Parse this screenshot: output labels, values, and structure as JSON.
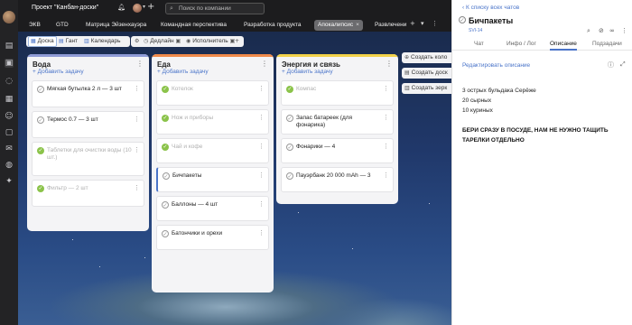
{
  "header": {
    "project_title": "Проект \"Канбан-доски\"",
    "search_placeholder": "Поиск по компании"
  },
  "tabs": [
    {
      "label": "ЭКВ"
    },
    {
      "label": "GTD"
    },
    {
      "label": "Матрица Эйзенхауэра"
    },
    {
      "label": "Командная перспектива"
    },
    {
      "label": "Разработка продукта"
    },
    {
      "label": "Апокалипсис",
      "active": true
    },
    {
      "label": "Развлечени"
    }
  ],
  "toolbar": {
    "board": "Доска",
    "gantt": "Гант",
    "calendar": "Календарь",
    "deadline": "Дедлайн",
    "assignee": "Исполнитель"
  },
  "add_task_label": "+ Добавить задачу",
  "columns": [
    {
      "title": "Вода",
      "color": "#8f9bd6",
      "cards": [
        {
          "text": "Мягкая бутылка 2 л — 3 шт",
          "done": false
        },
        {
          "text": "Термос 0.7 — 3 шт",
          "done": false
        },
        {
          "text": "Таблетки для очистки воды (10 шт.)",
          "done": true
        },
        {
          "text": "Фильтр — 2 шт",
          "done": true
        }
      ]
    },
    {
      "title": "Еда",
      "color": "#f08a4b",
      "cards": [
        {
          "text": "Котелок",
          "done": true
        },
        {
          "text": "Нож и приборы",
          "done": true
        },
        {
          "text": "Чай и кофе",
          "done": true
        },
        {
          "text": "Бичпакеты",
          "done": false,
          "selected": true
        },
        {
          "text": "Баллоны — 4 шт",
          "done": false
        },
        {
          "text": "Батончики и орехи",
          "done": false
        }
      ]
    },
    {
      "title": "Энергия и связь",
      "color": "#f2d24a",
      "cards": [
        {
          "text": "Компас",
          "done": true
        },
        {
          "text": "Запас батареек (для фонарика)",
          "done": false
        },
        {
          "text": "Фонарики — 4",
          "done": false
        },
        {
          "text": "Пауэрбанк 20 000 mAh — 3",
          "done": false
        }
      ]
    }
  ],
  "side_actions": [
    {
      "label": "Создать коло"
    },
    {
      "label": "Создать доск"
    },
    {
      "label": "Создать зерк"
    }
  ],
  "panel": {
    "back": "К списку всех чатов",
    "title": "Бичпакеты",
    "id": "SVI-14",
    "tabs": [
      "Чат",
      "Инфо / Лог",
      "Описание",
      "Подзадачи"
    ],
    "active_tab": "Описание",
    "edit_description": "Редактировать описание",
    "lines": [
      "3 острых бульдака Серёже",
      "20 сырных",
      "10 куриных"
    ],
    "bold_note": "БЕРИ СРАЗУ В ПОСУДЕ, НАМ НЕ НУЖНО ТАЩИТЬ ТАРЕЛКИ ОТДЕЛЬНО"
  }
}
